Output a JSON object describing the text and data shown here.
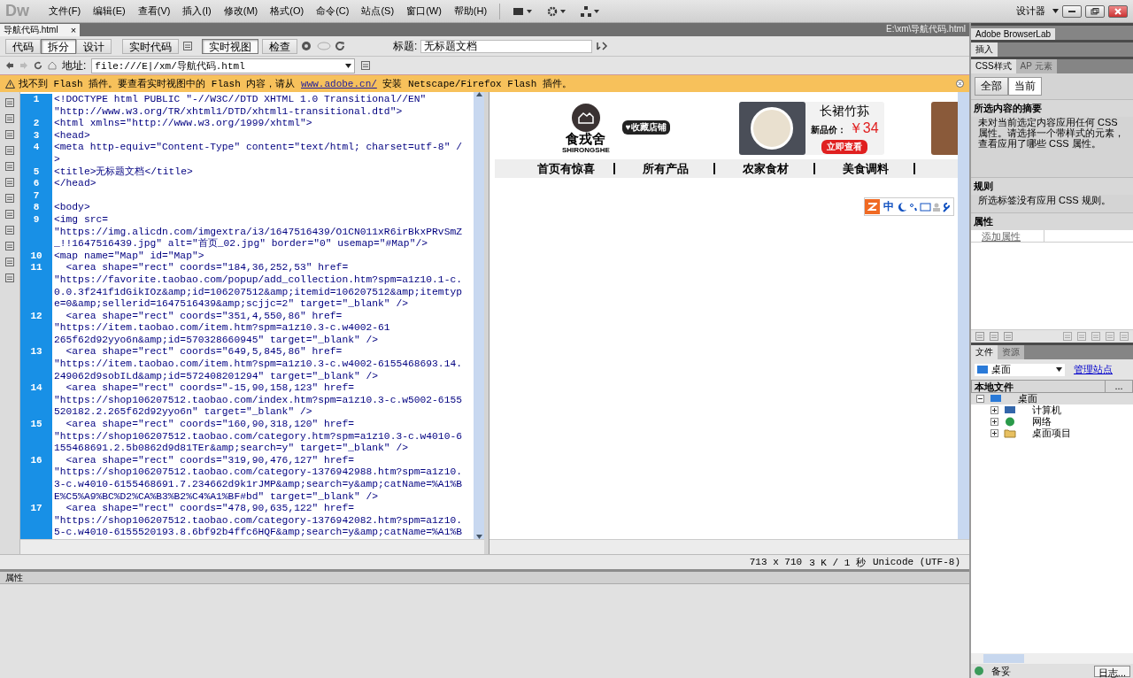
{
  "app": {
    "logo": "Dw",
    "menus": [
      "文件(F)",
      "编辑(E)",
      "查看(V)",
      "插入(I)",
      "修改(M)",
      "格式(O)",
      "命令(C)",
      "站点(S)",
      "窗口(W)",
      "帮助(H)"
    ],
    "workspace": "设计器"
  },
  "document_tabs": [
    {
      "label": "导航代码.html",
      "selected": true,
      "close": "×"
    }
  ],
  "file_path": "E:\\xm\\导航代码.html",
  "view_buttons": [
    {
      "label": "代码",
      "selected": false
    },
    {
      "label": "拆分",
      "selected": true
    },
    {
      "label": "设计",
      "selected": false
    }
  ],
  "live_buttons": [
    {
      "label": "实时代码",
      "selected": false
    },
    {
      "label": "实时视图",
      "selected": true
    },
    {
      "label": "检查",
      "selected": false
    }
  ],
  "title_field": {
    "label": "标题:",
    "value": "无标题文档"
  },
  "address_bar": {
    "label": "地址:",
    "value": "file:///E|/xm/导航代码.html"
  },
  "flash_notice": {
    "before": "找不到 Flash 插件。要查看实时视图中的 Flash 内容，请从 ",
    "link": "www.adobe.cn/",
    "after": " 安装 Netscape/Firefox Flash 插件。"
  },
  "code_lines": [
    {
      "number": "1",
      "rows": [
        "<!DOCTYPE html PUBLIC \"-//W3C//DTD XHTML 1.0 Transitional//EN\"",
        "\"http://www.w3.org/TR/xhtml1/DTD/xhtml1-transitional.dtd\">"
      ]
    },
    {
      "number": "2",
      "rows": [
        "<html xmlns=\"http://www.w3.org/1999/xhtml\">"
      ]
    },
    {
      "number": "3",
      "rows": [
        "<head>"
      ]
    },
    {
      "number": "4",
      "rows": [
        "<meta http-equiv=\"Content-Type\" content=\"text/html; charset=utf-8\" /",
        ">"
      ]
    },
    {
      "number": "5",
      "rows": [
        "<title>无标题文档</title>"
      ]
    },
    {
      "number": "6",
      "rows": [
        "</head>"
      ]
    },
    {
      "number": "7"
    },
    {
      "number": "8",
      "rows": [
        "<body>"
      ]
    },
    {
      "number": "9",
      "rows": [
        "<img src=",
        "\"https://img.alicdn.com/imgextra/i3/1647516439/O1CN011xR6irBkxPRvSmZ",
        "_!!1647516439.jpg\" alt=\"首页_02.jpg\" border=\"0\" usemap=\"#Map\"/>"
      ]
    },
    {
      "number": "10",
      "rows": [
        "<map name=\"Map\" id=\"Map\">"
      ]
    },
    {
      "number": "11",
      "rows": [
        "  <area shape=\"rect\" coords=\"184,36,252,53\" href=",
        "\"https://favorite.taobao.com/popup/add_collection.htm?spm=a1z10.1-c.",
        "0.0.3f241f1dGikIOz&amp;id=106207512&amp;itemid=106207512&amp;itemtyp",
        "e=0&amp;sellerid=1647516439&amp;scjjc=2\" target=\"_blank\" />"
      ]
    },
    {
      "number": "12",
      "rows": [
        "  <area shape=\"rect\" coords=\"351,4,550,86\" href=",
        "\"https://item.taobao.com/item.htm?spm=a1z10.3-c.w4002-61",
        "265f62d92yyo6n&amp;id=570328660945\" target=\"_blank\" />"
      ]
    },
    {
      "number": "13",
      "rows": [
        "  <area shape=\"rect\" coords=\"649,5,845,86\" href=",
        "\"https://item.taobao.com/item.htm?spm=a1z10.3-c.w4002-6155468693.14.",
        "249062d9sobILd&amp;id=572408201294\" target=\"_blank\" />"
      ]
    },
    {
      "number": "14",
      "rows": [
        "  <area shape=\"rect\" coords=\"-15,90,158,123\" href=",
        "\"https://shop106207512.taobao.com/index.htm?spm=a1z10.3-c.w5002-6155",
        "520182.2.265f62d92yyo6n\" target=\"_blank\" />"
      ]
    },
    {
      "number": "15",
      "rows": [
        "  <area shape=\"rect\" coords=\"160,90,318,120\" href=",
        "\"https://shop106207512.taobao.com/category.htm?spm=a1z10.3-c.w4010-6",
        "155468691.2.5b0862d9d81TEr&amp;search=y\" target=\"_blank\" />"
      ]
    },
    {
      "number": "16",
      "rows": [
        "  <area shape=\"rect\" coords=\"319,90,476,127\" href=",
        "\"https://shop106207512.taobao.com/category-1376942988.htm?spm=a1z10.",
        "3-c.w4010-6155468691.7.234662d9k1rJMP&amp;search=y&amp;catName=%A1%B",
        "E%C5%A9%BC%D2%CA%B3%B2%C4%A1%BF#bd\" target=\"_blank\" />"
      ]
    },
    {
      "number": "17",
      "rows": [
        "  <area shape=\"rect\" coords=\"478,90,635,122\" href=",
        "\"https://shop106207512.taobao.com/category-1376942082.htm?spm=a1z10.",
        "5-c.w4010-6155520193.8.6bf92b4ffc6HQF&amp;search=y&amp;catName=%A1%B"
      ]
    }
  ],
  "design_view": {
    "shop_name": "食戎舍",
    "shop_name_latin": "SHIRONGSHE",
    "favorite_badge": "♥收藏店铺",
    "product_name": "长裙竹荪",
    "price_label": "新品价：",
    "price": "￥34",
    "view_button": "立即查看",
    "nav_items": [
      "首页有惊喜",
      "所有产品",
      "农家食材",
      "美食调料"
    ],
    "ime_label": "中"
  },
  "status_bar": {
    "size": "713 x 710",
    "transfer": "3 K / 1 秒",
    "encoding": "Unicode (UTF-8)"
  },
  "properties_panel": {
    "title": "属性"
  },
  "right_panel": {
    "groups": [
      "Adobe BrowserLab",
      "插入"
    ],
    "css_tabs": [
      {
        "label": "CSS样式",
        "selected": true
      },
      {
        "label": "AP 元素",
        "selected": false
      }
    ],
    "mode_buttons": [
      {
        "label": "全部",
        "selected": false
      },
      {
        "label": "当前",
        "selected": true
      }
    ],
    "summary_title": "所选内容的摘要",
    "summary_text": "未对当前选定内容应用任何 CSS 属性。请选择一个带样式的元素，查看应用了哪些 CSS 属性。",
    "rules_title": "规则",
    "rules_text": "所选标签没有应用 CSS 规则。",
    "properties_title": "属性",
    "add_property": "添加属性",
    "file_tabs": [
      {
        "label": "文件",
        "selected": true
      },
      {
        "label": "资源",
        "selected": false
      }
    ],
    "site_select": "桌面",
    "manage_sites": "管理站点",
    "local_files": "本地文件",
    "column_more": "...",
    "tree": [
      {
        "label": "桌面",
        "kind": "desktop",
        "expanded": true,
        "children": [
          {
            "label": "计算机",
            "kind": "computer",
            "expanded": false
          },
          {
            "label": "网络",
            "kind": "network",
            "expanded": false
          },
          {
            "label": "桌面项目",
            "kind": "folder",
            "expanded": false
          }
        ]
      }
    ],
    "status": "备妥",
    "log_button": "日志..."
  }
}
